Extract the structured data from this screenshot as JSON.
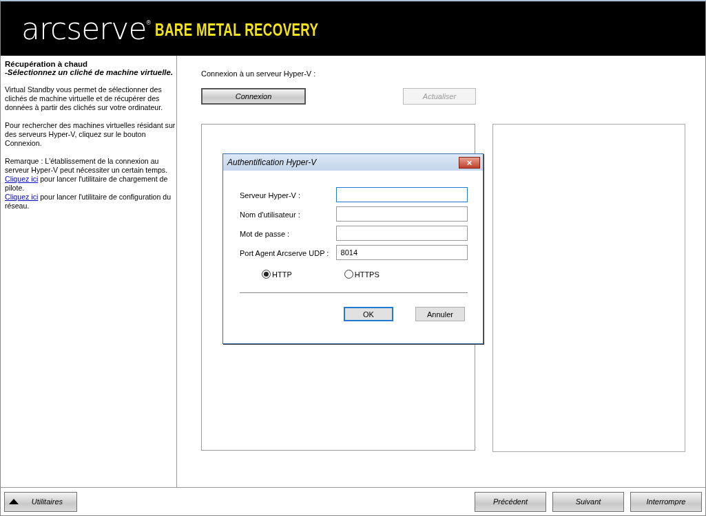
{
  "header": {
    "brand": "arcserve",
    "registered": "®",
    "product": "BARE METAL RECOVERY"
  },
  "sidebar": {
    "title": "Récupération à chaud",
    "subtitle": "-Sélectionnez un cliché de machine virtuelle.",
    "paragraphs": [
      "Virtual Standby vous permet de sélectionner des clichés de machine virtuelle et de récupérer des données à partir des clichés sur votre ordinateur.",
      "Pour rechercher des machines virtuelles résidant sur des serveurs Hyper-V, cliquez sur le bouton Connexion.",
      "Remarque : L'établissement de la connexion au serveur Hyper-V peut nécessiter un certain temps."
    ],
    "links": [
      {
        "link": "Cliquez ici",
        "text": " pour lancer l'utilitaire de chargement de pilote."
      },
      {
        "link": "Cliquez ici",
        "text": " pour lancer l'utilitaire de configuration du réseau."
      }
    ]
  },
  "main": {
    "label": "Connexion à un serveur Hyper-V :",
    "buttons": [
      {
        "label": "Connexion",
        "disabled": false
      },
      {
        "label": "Actualiser",
        "disabled": true
      }
    ]
  },
  "dialog": {
    "title": "Authentification Hyper-V",
    "close": "×",
    "fields": [
      {
        "label": "Serveur Hyper-V :",
        "focused": true
      },
      {
        "label": "Nom d'utilisateur :",
        "focused": false
      },
      {
        "label": "Mot de passe :",
        "focused": false
      },
      {
        "label": "Port Agent Arcserve UDP :",
        "value": "8014",
        "focused": false
      }
    ],
    "protocols": [
      {
        "label": "HTTP",
        "selected": true
      },
      {
        "label": "HTTPS",
        "selected": false
      }
    ],
    "buttons": [
      {
        "label": "OK",
        "default": true
      },
      {
        "label": "Annuler",
        "default": false
      }
    ]
  },
  "footer": {
    "utilities": "Utilitaires",
    "buttons": [
      "Précédent",
      "Suivant",
      "Interrompre"
    ]
  }
}
